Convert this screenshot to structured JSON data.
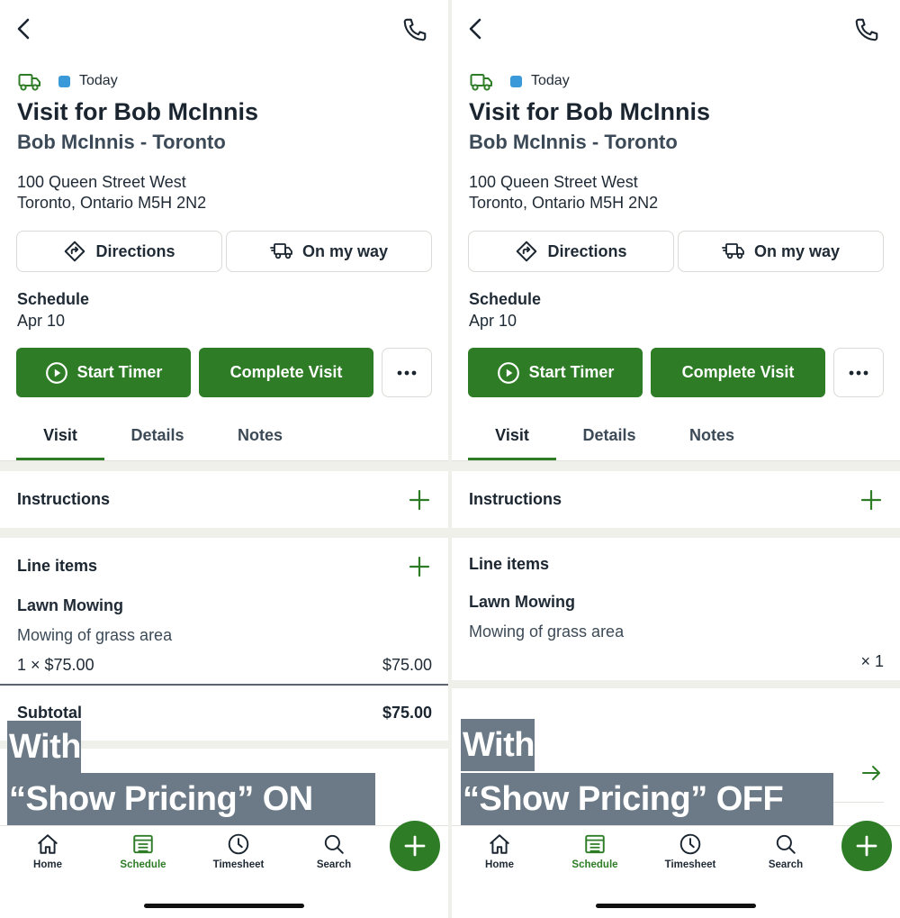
{
  "colors": {
    "brand_green": "#2e7d26",
    "status_blue": "#3a9ad9",
    "overlay_gray": "#6b7a86",
    "band": "#f0f0eb"
  },
  "header": {
    "back_icon": "chevron-left-icon",
    "phone_icon": "phone-icon"
  },
  "status": {
    "icon": "truck-icon",
    "text": "Today"
  },
  "title": "Visit for Bob McInnis",
  "subtitle": "Bob McInnis - Toronto",
  "address": {
    "line1": "100 Queen Street West",
    "line2": "Toronto, Ontario M5H 2N2"
  },
  "actions": {
    "directions": "Directions",
    "on_my_way": "On my way"
  },
  "schedule": {
    "label": "Schedule",
    "date": "Apr 10"
  },
  "buttons": {
    "start_timer": "Start Timer",
    "complete_visit": "Complete Visit",
    "more": "more-icon"
  },
  "tabs": [
    {
      "label": "Visit",
      "active": true
    },
    {
      "label": "Details"
    },
    {
      "label": "Notes"
    }
  ],
  "instructions": {
    "label": "Instructions"
  },
  "line_items": {
    "label": "Line items",
    "item": {
      "name": "Lawn Mowing",
      "description": "Mowing of grass area",
      "qty_price": "1 × $75.00",
      "amount": "$75.00",
      "qty_only": "× 1"
    }
  },
  "subtotal": {
    "label": "Subtotal",
    "amount": "$75.00"
  },
  "overlays": {
    "left": {
      "line1": "With",
      "line2": "“Show Pricing” ON"
    },
    "right": {
      "line1": "With",
      "line2": "“Show Pricing” OFF"
    }
  },
  "nav": [
    {
      "label": "Home",
      "icon": "home-icon"
    },
    {
      "label": "Schedule",
      "icon": "schedule-icon",
      "active": true
    },
    {
      "label": "Timesheet",
      "icon": "clock-icon"
    },
    {
      "label": "Search",
      "icon": "search-icon"
    }
  ],
  "fab": {
    "icon": "plus-icon"
  }
}
